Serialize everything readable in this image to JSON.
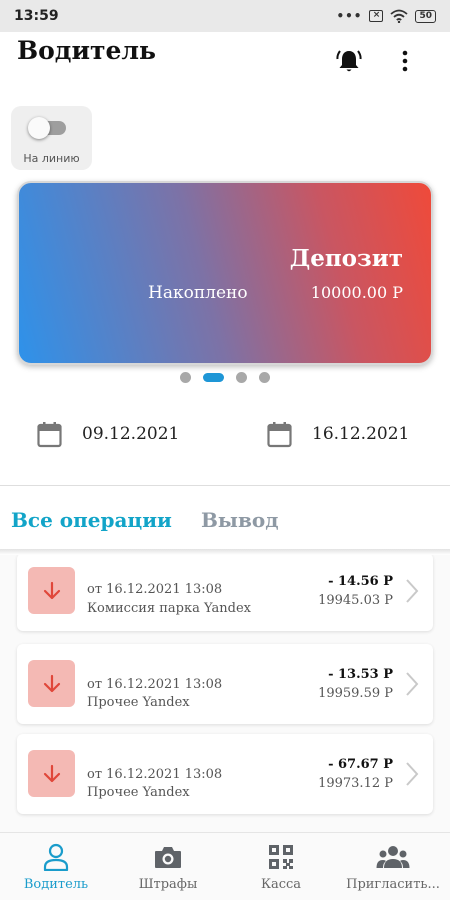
{
  "status_bar": {
    "time": "13:59",
    "dots": "•••",
    "battery": "50"
  },
  "header": {
    "title": "Водитель"
  },
  "online_toggle": {
    "label": "На линию",
    "state": "off"
  },
  "deposit_card": {
    "title": "Депозит",
    "label": "Накоплено",
    "amount": "10000.00 Р"
  },
  "pager": {
    "count": 4,
    "active_index": 1
  },
  "date_range": {
    "from": "09.12.2021",
    "to": "16.12.2021"
  },
  "tabs": [
    {
      "label": "Все операции",
      "active": true
    },
    {
      "label": "Вывод",
      "active": false
    }
  ],
  "operations": [
    {
      "date": "от 16.12.2021 13:08",
      "title": "Комиссия парка Yandex",
      "amount": "- 14.56 Р",
      "balance": "19945.03 Р",
      "icon": "arrow-down-icon"
    },
    {
      "date": "от 16.12.2021 13:08",
      "title": "Прочее Yandex",
      "amount": "- 13.53 Р",
      "balance": "19959.59 Р",
      "icon": "arrow-down-icon"
    },
    {
      "date": "от 16.12.2021 13:08",
      "title": "Прочее Yandex",
      "amount": "- 67.67 Р",
      "balance": "19973.12 Р",
      "icon": "arrow-down-icon"
    }
  ],
  "bottom_nav": [
    {
      "label": "Водитель",
      "icon": "person-icon",
      "active": true
    },
    {
      "label": "Штрафы",
      "icon": "camera-icon",
      "active": false
    },
    {
      "label": "Касса",
      "icon": "qr-code-icon",
      "active": false
    },
    {
      "label": "Пригласить...",
      "icon": "group-icon",
      "active": false
    }
  ],
  "colors": {
    "accent": "#1a9ccb",
    "tab_inactive": "#8e99a4",
    "card_gradient_start": "#2e92ea",
    "card_gradient_end": "#ef4a3a",
    "operation_icon_bg": "#f4b9b4",
    "operation_icon_arrow": "#e0473a"
  }
}
